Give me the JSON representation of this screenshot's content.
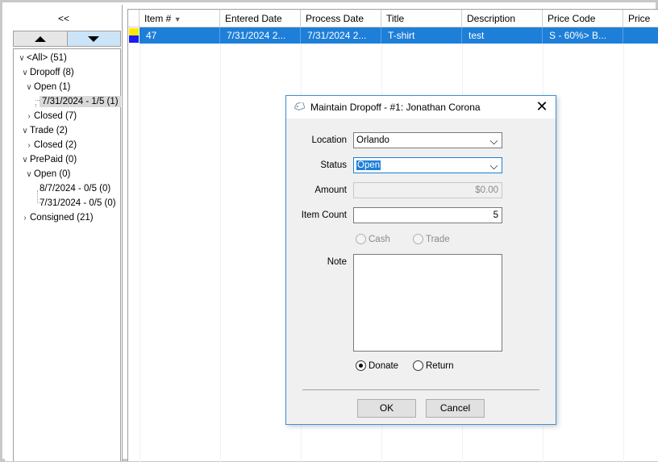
{
  "left_panel": {
    "collapse_label": "<<",
    "tree": [
      {
        "label": "<All> (51)"
      },
      {
        "label": "Dropoff (8)"
      },
      {
        "label": "Open (1)"
      },
      {
        "label": "7/31/2024 - 1/5 (1)"
      },
      {
        "label": "Closed (7)"
      },
      {
        "label": "Trade (2)"
      },
      {
        "label": "Closed (2)"
      },
      {
        "label": "PrePaid (0)"
      },
      {
        "label": "Open (0)"
      },
      {
        "label": "8/7/2024 - 0/5 (0)"
      },
      {
        "label": "7/31/2024 - 0/5 (0)"
      },
      {
        "label": "Consigned (21)"
      }
    ]
  },
  "grid": {
    "columns": [
      "Item #",
      "Entered Date",
      "Process Date",
      "Title",
      "Description",
      "Price Code",
      "Price"
    ],
    "rows": [
      [
        "47",
        "7/31/2024 2...",
        "7/31/2024 2...",
        "T-shirt",
        "test",
        "S - 60%> B...",
        ""
      ]
    ],
    "colors": {
      "selection": "#1e7fd8",
      "indicator_top": "#ffe800",
      "indicator_bottom": "#1c1cf0"
    }
  },
  "dialog": {
    "title": "Maintain Dropoff - #1: Jonathan Corona",
    "location_label": "Location",
    "location_value": "Orlando",
    "status_label": "Status",
    "status_value": "Open",
    "amount_label": "Amount",
    "amount_value": "$0.00",
    "item_count_label": "Item Count",
    "item_count_value": "5",
    "cash_label": "Cash",
    "trade_label": "Trade",
    "note_label": "Note",
    "donate_label": "Donate",
    "return_label": "Return",
    "ok_label": "OK",
    "cancel_label": "Cancel"
  }
}
